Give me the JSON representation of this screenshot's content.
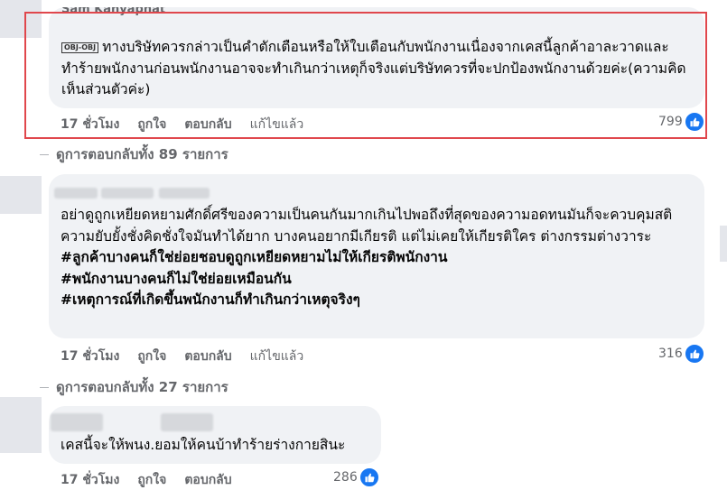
{
  "comments": [
    {
      "author": "Sam Kanyaphat",
      "badge": "OBJ-OBJ",
      "text": "ทางบริษัทควรกล่าวเป็นคำตักเตือนหรือให้ใบเตือนกับพนักงานเนื่องจากเคสนี้ลูกค้าอาละวาดและทำร้ายพนักงานก่อนพนักงานอาจจะทำเกินกว่าเหตุก็จริงแต่บริษัทควรที่จะปกป้องพนักงานด้วยค่ะ(ความคิดเห็นส่วนตัวค่ะ)",
      "time": "17 ชั่วโมง",
      "like": "ถูกใจ",
      "reply": "ตอบกลับ",
      "edited": "แก้ไขแล้ว",
      "reactions": "799"
    },
    {
      "text": "อย่าดูถูกเหยียดหยามศักดิ์ศรีของความเป็นคนกันมากเกินไปพอถึงที่สุดของความอดทนมันก็จะควบคุมสติความยับยั้งชั่งคิดชั่งใจมันทำได้ยาก บางคนอยากมีเกียรติ แต่ไม่เคยให้เกียรติใคร ต่างกรรมต่างวาระ",
      "hashtags": [
        "#ลูกค้าบางคนก็ใช่ย่อยชอบดูถูกเหยียดหยามไม่ให้เกียรติพนักงาน",
        "#พนักงานบางคนก็ไม่ใช่ย่อยเหมือนกัน",
        "#เหตุการณ์ที่เกิดขึ้นพนักงานก็ทำเกินกว่าเหตุจริงๆ"
      ],
      "time": "17 ชั่วโมง",
      "like": "ถูกใจ",
      "reply": "ตอบกลับ",
      "edited": "แก้ไขแล้ว",
      "reactions": "316"
    },
    {
      "text": "เคสนี้จะให้พนง.ยอมให้คนบ้าทำร้ายร่างกายสินะ",
      "time": "17 ชั่วโมง",
      "like": "ถูกใจ",
      "reply": "ตอบกลับ",
      "reactions": "286"
    }
  ],
  "view_replies": [
    "ดูการตอบกลับทั้ง 89 รายการ",
    "ดูการตอบกลับทั้ง 27 รายการ"
  ],
  "colors": {
    "like_blue": "#1877f2",
    "bubble": "#f0f2f5",
    "highlight": "#e0474c"
  }
}
